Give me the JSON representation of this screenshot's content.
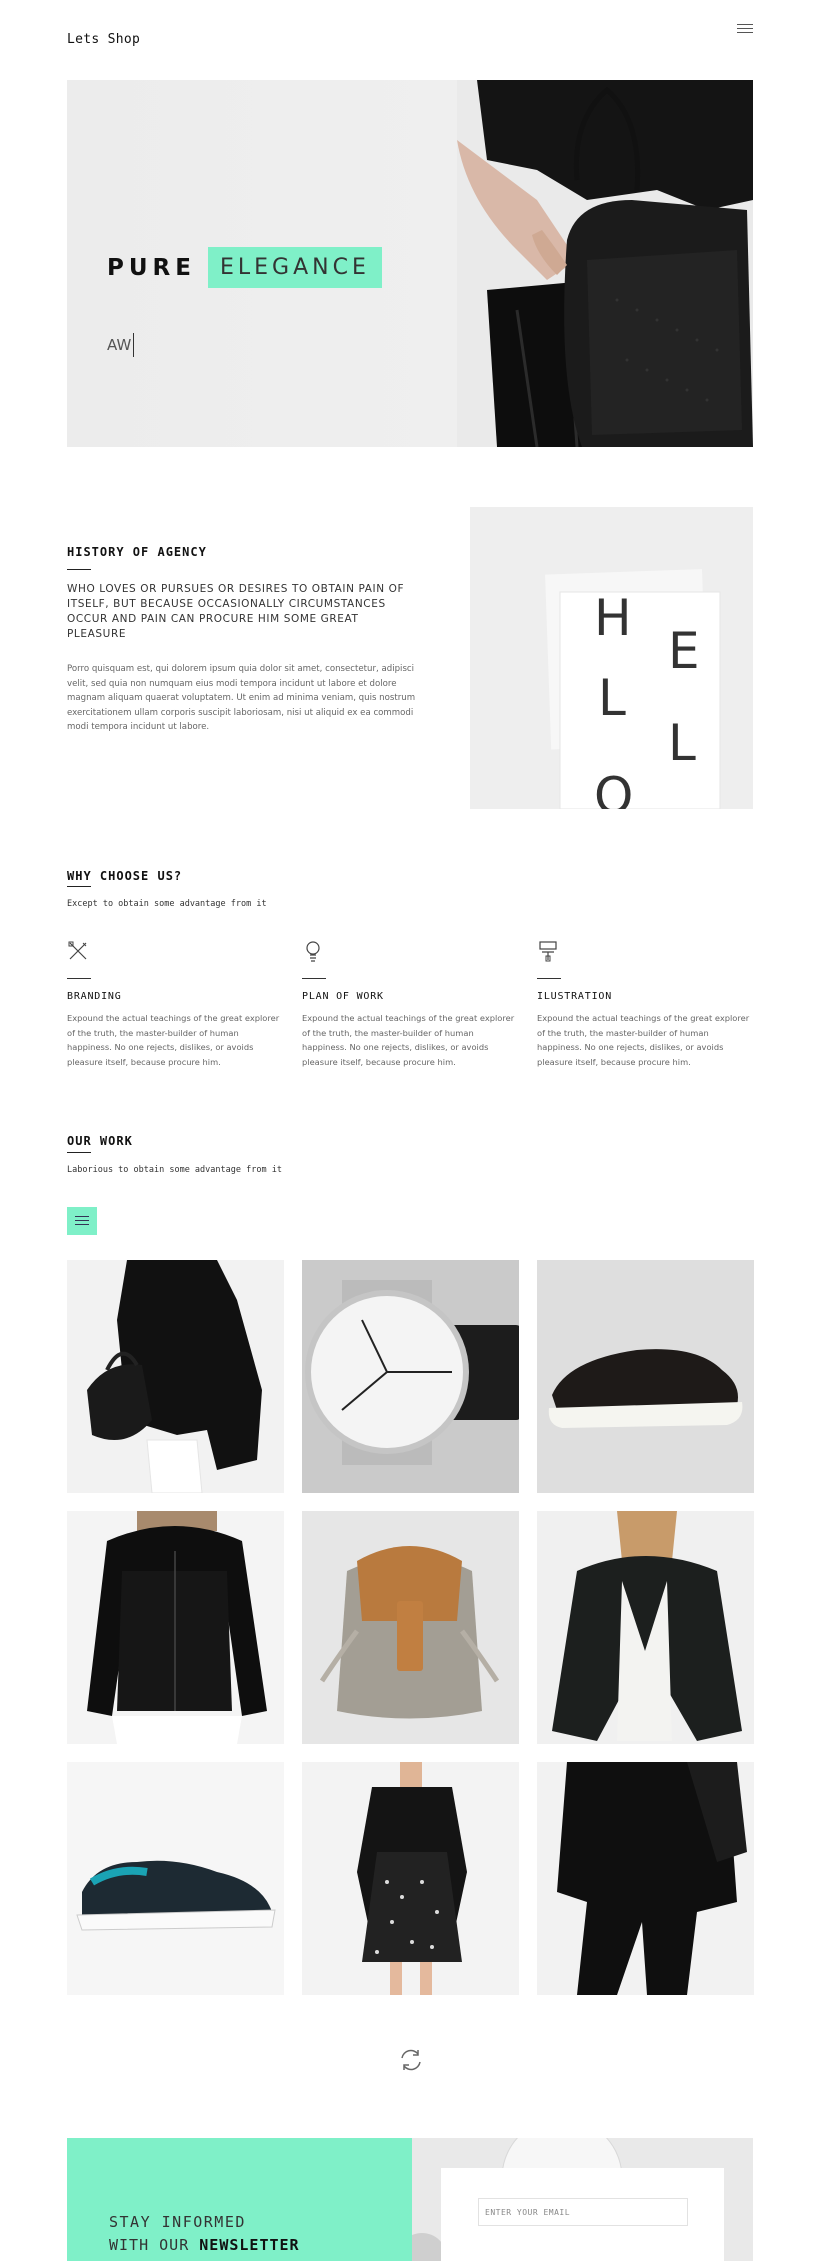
{
  "header": {
    "brand": "Lets Shop",
    "menu_icon": "hamburger-icon"
  },
  "hero": {
    "title_word1": "PURE",
    "title_word2": "ELEGANCE",
    "typed_text": "AW"
  },
  "history": {
    "title": "HISTORY OF AGENCY",
    "subtitle": "WHO LOVES OR PURSUES OR DESIRES TO OBTAIN PAIN OF ITSELF, BUT BECAUSE OCCASIONALLY CIRCUMSTANCES OCCUR AND PAIN CAN PROCURE HIM SOME GREAT PLEASURE",
    "body": "Porro quisquam est, qui dolorem ipsum quia dolor sit amet, consectetur, adipisci velit, sed quia non numquam eius modi tempora incidunt ut labore et dolore magnam aliquam quaerat voluptatem. Ut enim ad minima veniam, quis nostrum exercitationem ullam corporis suscipit laboriosam, nisi ut aliquid ex ea commodi modi tempora incidunt ut labore.",
    "image_letters": [
      "H",
      "E",
      "L",
      "L",
      "O"
    ]
  },
  "why": {
    "title": "WHY CHOOSE US?",
    "subtitle": "Except to obtain some advantage from it",
    "features": [
      {
        "icon": "pencil-ruler-icon",
        "title": "BRANDING",
        "text": "Expound the actual teachings of the great explorer of the truth, the master-builder of human happiness. No one rejects, dislikes, or avoids pleasure itself, because procure him."
      },
      {
        "icon": "lightbulb-icon",
        "title": "PLAN OF WORK",
        "text": "Expound the actual teachings of the great explorer of the truth, the master-builder of human happiness. No one rejects, dislikes, or avoids pleasure itself, because procure him."
      },
      {
        "icon": "paint-roller-icon",
        "title": "ILUSTRATION",
        "text": "Expound the actual teachings of the great explorer of the truth, the master-builder of human happiness. No one rejects, dislikes, or avoids pleasure itself, because procure him."
      }
    ]
  },
  "work": {
    "title": "OUR WORK",
    "subtitle": "Laborious to obtain some advantage from it",
    "filter_icon": "menu-filter-icon",
    "items": [
      "black-knit-outfit-with-handbag",
      "minimal-wristwatch",
      "black-slip-on-shoe",
      "black-leather-hooded-jacket",
      "canvas-leather-backpack",
      "black-leather-blazer",
      "black-teal-sneaker",
      "polka-dot-dress-leather-jacket",
      "black-sweater-outfit"
    ]
  },
  "reload_icon": "reload-icon",
  "newsletter": {
    "line1": "STAY INFORMED",
    "line2_prefix": "WITH OUR",
    "line2_bold": "NEWSLETTER",
    "email_placeholder": "ENTER YOUR EMAIL"
  },
  "colors": {
    "accent": "#7ff0c8",
    "text": "#222222",
    "muted": "#666666"
  }
}
